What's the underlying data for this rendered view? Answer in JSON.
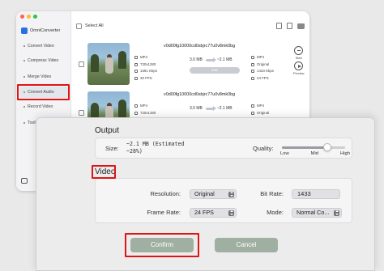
{
  "app": {
    "name": "OmniConverter",
    "sidebar": [
      "Convert Video",
      "Compress Video",
      "Merge Video",
      "Convert Audio",
      "Record Video",
      "Toolbox"
    ],
    "active_index": 3,
    "select_all": "Select All",
    "rows": [
      {
        "filename": "v0d00fg10000cd0sbjrc77u0v8mk0bg",
        "left_attrs": [
          "MP4",
          "720x1280",
          "1591 Kbps",
          "30 FPS"
        ],
        "size_from": "3.0 MB",
        "size_to": "~2.1 MB",
        "right_attrs": [
          "MP4",
          "Original",
          "1433 Kbps",
          "24 FPS"
        ],
        "edit_label": "Edit",
        "actions": [
          "Start",
          "Preview"
        ]
      },
      {
        "filename": "v0d00fg10000cd0sbjrc77u0v8mk0bg",
        "left_attrs": [
          "MP4",
          "720x1280",
          "1591 Kbps",
          "30 FPS"
        ],
        "size_from": "3.0 MB",
        "size_to": "~2.1 MB",
        "right_attrs": [
          "MP4",
          "Original",
          "1433 Kbps",
          "24 FPS"
        ],
        "edit_label": "Edit",
        "actions": [
          "Start",
          "Preview"
        ]
      }
    ]
  },
  "dialog": {
    "output_title": "Output",
    "size_label": "Size:",
    "size_value": "~2.1 MB (Estimated\n~28%)",
    "quality_label": "Quality:",
    "quality_marks": [
      "Low",
      "Mid",
      "High"
    ],
    "quality_level": 0.72,
    "video_title": "Video",
    "resolution_label": "Resolution:",
    "resolution_value": "Original",
    "bitrate_label": "Bit Rate:",
    "bitrate_value": "1433",
    "framerate_label": "Frame Rate:",
    "framerate_value": "24 FPS",
    "mode_label": "Mode:",
    "mode_value": "Normal Co...",
    "confirm_label": "Confirm",
    "cancel_label": "Cancel"
  },
  "colors": {
    "highlight": "#e01414",
    "button": "#9fb0a2"
  }
}
